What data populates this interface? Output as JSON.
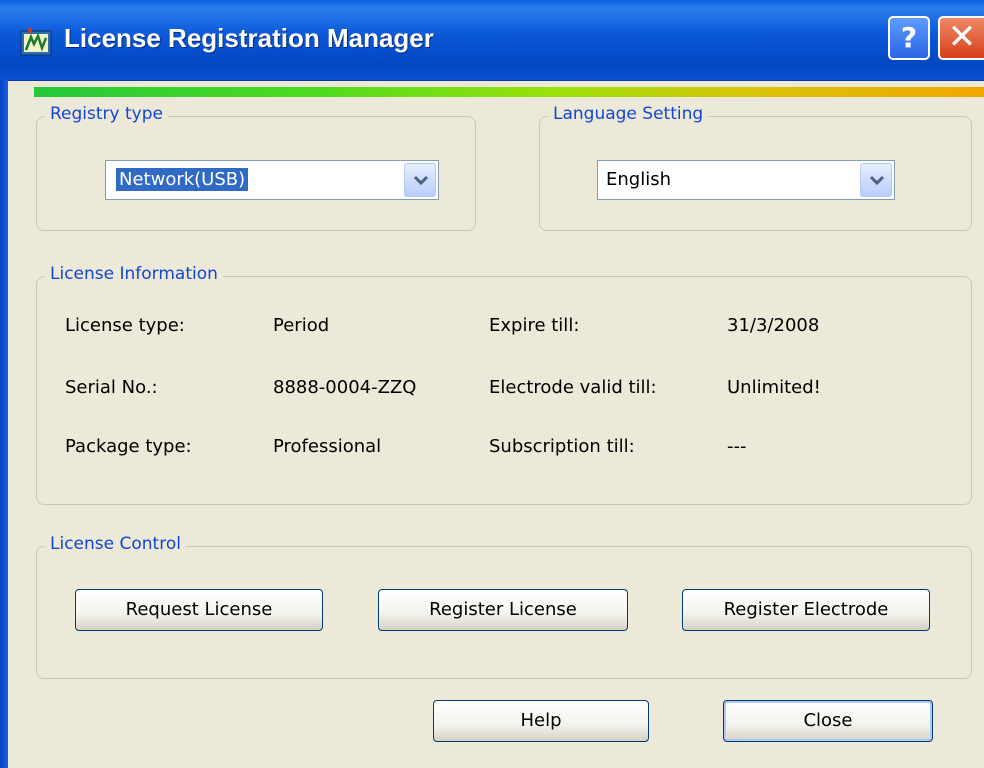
{
  "window": {
    "title": "License Registration Manager",
    "help_glyph": "?",
    "close_glyph": "✕"
  },
  "registry_type": {
    "legend": "Registry type",
    "value": "Network(USB)"
  },
  "language_setting": {
    "legend": "Language Setting",
    "value": "English"
  },
  "license_info": {
    "legend": "License Information",
    "rows": [
      {
        "label": "License type:",
        "value": "Period",
        "label2": "Expire till:",
        "value2": "31/3/2008"
      },
      {
        "label": "Serial No.:",
        "value": "8888-0004-ZZQ",
        "label2": "Electrode valid till:",
        "value2": "Unlimited!"
      },
      {
        "label": "Package type:",
        "value": "Professional",
        "label2": "Subscription till:",
        "value2": "---"
      }
    ]
  },
  "license_control": {
    "legend": "License Control",
    "request": "Request License",
    "register": "Register License",
    "register_electrode": "Register Electrode"
  },
  "footer": {
    "help": "Help",
    "close": "Close"
  },
  "colors": {
    "titlebar": "#0a57d6",
    "legend_text": "#1146d3",
    "dialog_bg": "#ece9d8",
    "selection": "#316ac5"
  },
  "icons": {
    "app": "license-app-icon",
    "dropdown": "chevron-down-icon"
  }
}
